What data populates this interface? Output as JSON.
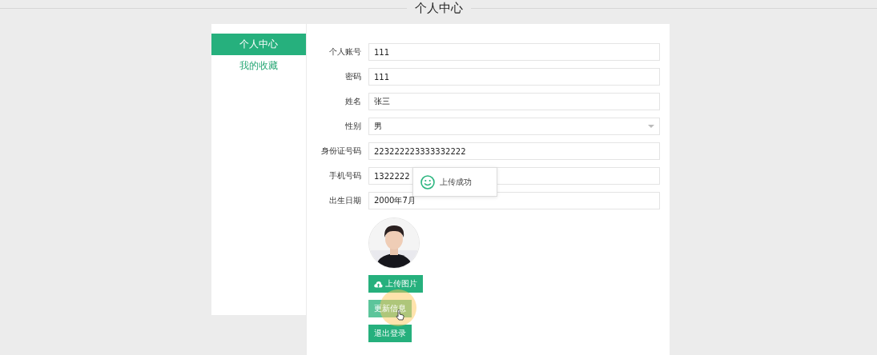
{
  "page_title": "个人中心",
  "sidebar": {
    "items": [
      {
        "label": "个人中心",
        "selected": true
      },
      {
        "label": "我的收藏",
        "selected": false
      }
    ]
  },
  "form": {
    "fields": [
      {
        "label": "个人账号",
        "kind": "text",
        "value": "111"
      },
      {
        "label": "密码",
        "kind": "text",
        "value": "111"
      },
      {
        "label": "姓名",
        "kind": "text",
        "value": "张三"
      },
      {
        "label": "性别",
        "kind": "select",
        "value": "男"
      },
      {
        "label": "身份证号码",
        "kind": "text",
        "value": "223222223333332222"
      },
      {
        "label": "手机号码",
        "kind": "text",
        "value": "1322222"
      },
      {
        "label": "出生日期",
        "kind": "text",
        "value": "2000年7月"
      }
    ],
    "buttons": [
      {
        "label": "上传图片",
        "kind": "upload",
        "hovered": false
      },
      {
        "label": "更新信息",
        "kind": "plain",
        "hovered": true
      },
      {
        "label": "退出登录",
        "kind": "plain",
        "hovered": false
      }
    ]
  },
  "toast": {
    "message": "上传成功"
  }
}
